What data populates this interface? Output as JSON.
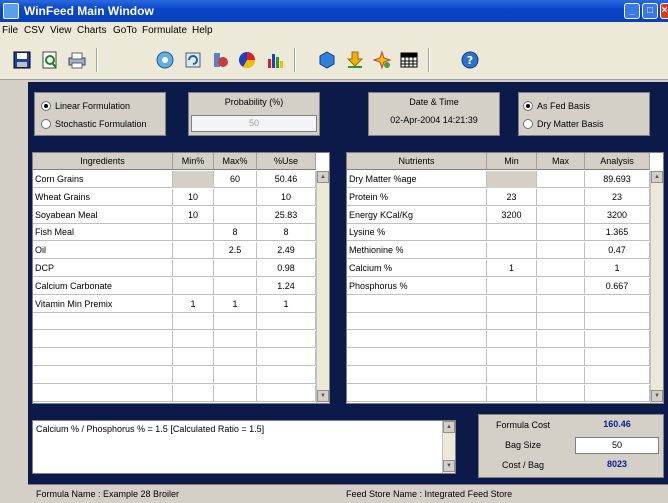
{
  "window": {
    "title": "WinFeed Main Window"
  },
  "menu": [
    "File",
    "CSV",
    "View",
    "Charts",
    "GoTo",
    "Formulate",
    "Help"
  ],
  "toolbar_icons": [
    "save-icon",
    "print-preview-icon",
    "print-icon",
    "cd-icon",
    "refresh-icon",
    "tools-icon",
    "pie-chart-icon",
    "bar-chart-icon",
    "database-icon",
    "download-icon",
    "sparkle-icon",
    "grid-icon",
    "help-icon"
  ],
  "formulation": {
    "linear": "Linear Formulation",
    "stochastic": "Stochastic Formulation",
    "selected": "linear"
  },
  "probability": {
    "label": "Probability (%)",
    "value": "50"
  },
  "datetime": {
    "label": "Date & Time",
    "value": "02-Apr-2004 14:21:39"
  },
  "basis": {
    "as_fed": "As Fed Basis",
    "dry_matter": "Dry Matter Basis",
    "selected": "as_fed"
  },
  "ingredients": {
    "headers": [
      "Ingredients",
      "Min%",
      "Max%",
      "%Use"
    ],
    "rows": [
      [
        "Corn Grains",
        "",
        "60",
        "50.46"
      ],
      [
        "Wheat Grains",
        "10",
        "",
        "10"
      ],
      [
        "Soyabean Meal",
        "10",
        "",
        "25.83"
      ],
      [
        "Fish Meal",
        "",
        "8",
        "8"
      ],
      [
        "Oil",
        "",
        "2.5",
        "2.49"
      ],
      [
        "DCP",
        "",
        "",
        "0.98"
      ],
      [
        "Calcium Carbonate",
        "",
        "",
        "1.24"
      ],
      [
        "Vitamin Min Premix",
        "1",
        "1",
        "1"
      ],
      [
        "",
        "",
        "",
        ""
      ],
      [
        "",
        "",
        "",
        ""
      ],
      [
        "",
        "",
        "",
        ""
      ],
      [
        "",
        "",
        "",
        ""
      ],
      [
        "",
        "",
        "",
        ""
      ]
    ]
  },
  "nutrients": {
    "headers": [
      "Nutrients",
      "Min",
      "Max",
      "Analysis"
    ],
    "rows": [
      [
        "Dry Matter %age",
        "",
        "",
        "89.693"
      ],
      [
        "Protein %",
        "23",
        "",
        "23"
      ],
      [
        "Energy KCal/Kg",
        "3200",
        "",
        "3200"
      ],
      [
        "Lysine %",
        "",
        "",
        "1.365"
      ],
      [
        "Methionine %",
        "",
        "",
        "0.47"
      ],
      [
        "Calcium %",
        "1",
        "",
        "1"
      ],
      [
        "Phosphorus %",
        "",
        "",
        "0.667"
      ],
      [
        "",
        "",
        "",
        ""
      ],
      [
        "",
        "",
        "",
        ""
      ],
      [
        "",
        "",
        "",
        ""
      ],
      [
        "",
        "",
        "",
        ""
      ],
      [
        "",
        "",
        "",
        ""
      ],
      [
        "",
        "",
        "",
        ""
      ]
    ]
  },
  "ratio_text": "Calcium %  /  Phosphorus %  =  1.5  [Calculated Ratio = 1.5]",
  "cost": {
    "formula_cost_label": "Formula Cost",
    "formula_cost": "160.46",
    "bag_size_label": "Bag  Size",
    "bag_size": "50",
    "cost_per_bag_label": "Cost / Bag",
    "cost_per_bag": "8023"
  },
  "status": {
    "formula_name": "Formula Name :  Example 28 Broiler",
    "feed_store": "Feed Store Name :  Integrated Feed Store"
  }
}
